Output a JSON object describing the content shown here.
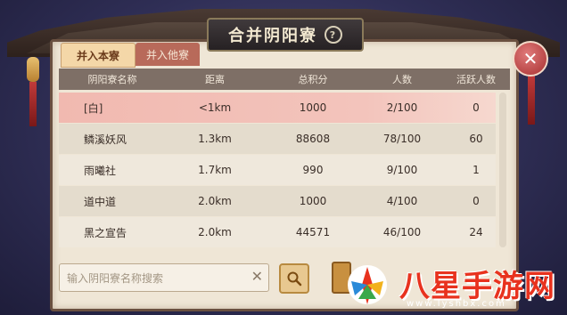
{
  "window": {
    "title": "合并阴阳寮"
  },
  "tabs": [
    {
      "label": "并入本寮",
      "active": true
    },
    {
      "label": "并入他寮",
      "active": false
    }
  ],
  "table": {
    "columns": [
      "阴阳寮名称",
      "距离",
      "总积分",
      "人数",
      "活跃人数"
    ],
    "rows": [
      {
        "name": "[白]",
        "distance": "<1km",
        "points": "1000",
        "members": "2/100",
        "active": "0",
        "selected": true
      },
      {
        "name": "鳞溪妖风",
        "distance": "1.3km",
        "points": "88608",
        "members": "78/100",
        "active": "60"
      },
      {
        "name": "雨曦社",
        "distance": "1.7km",
        "points": "990",
        "members": "9/100",
        "active": "1"
      },
      {
        "name": "道中道",
        "distance": "2.0km",
        "points": "1000",
        "members": "4/100",
        "active": "0"
      },
      {
        "name": "黑之宣告",
        "distance": "2.0km",
        "points": "44571",
        "members": "46/100",
        "active": "24"
      }
    ]
  },
  "search": {
    "placeholder": "输入阴阳寮名称搜索",
    "value": ""
  },
  "watermark": {
    "text": "八星手游网",
    "url": "www.lyshbx.com"
  },
  "colors": {
    "selected_row": "#f1b9b0",
    "header_bg": "#7e6f66",
    "close_button": "#a83030"
  }
}
